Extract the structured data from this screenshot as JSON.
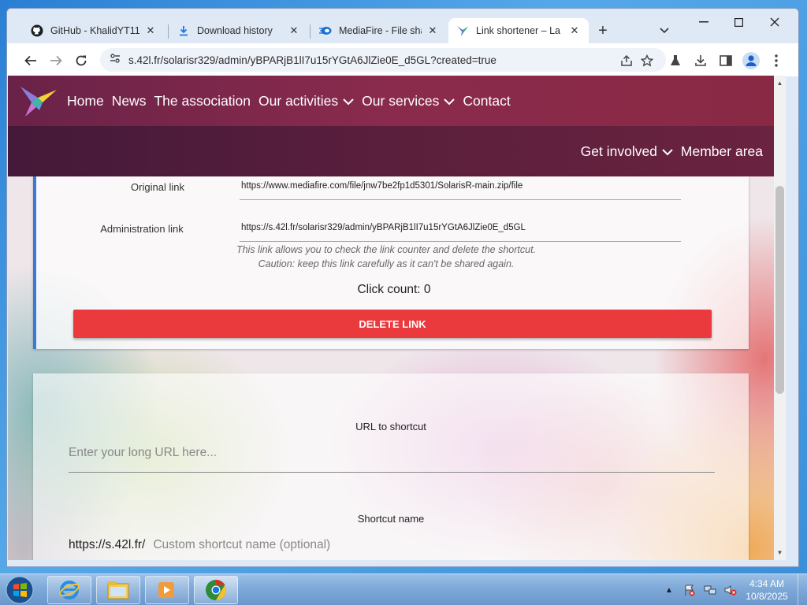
{
  "browser": {
    "tabs": [
      {
        "title": "GitHub - KhalidYT11...",
        "icon": "github-icon"
      },
      {
        "title": "Download history",
        "icon": "download-icon"
      },
      {
        "title": "MediaFire - File shar...",
        "icon": "mediafire-icon"
      },
      {
        "title": "Link shortener – La C",
        "icon": "hummingbird-icon",
        "active": true
      }
    ],
    "url": "s.42l.fr/solarisr329/admin/yBPARjB1lI7u15rYGtA6JlZie0E_d5GL?created=true"
  },
  "site": {
    "nav": {
      "home": "Home",
      "news": "News",
      "association": "The association",
      "activities": "Our activities",
      "services": "Our services",
      "contact": "Contact",
      "get_involved": "Get involved",
      "member_area": "Member area"
    },
    "result": {
      "original_label": "Original link",
      "original_value": "https://www.mediafire.com/file/jnw7be2fp1d5301/SolarisR-main.zip/file",
      "admin_label": "Administration link",
      "admin_value": "https://s.42l.fr/solarisr329/admin/yBPARjB1lI7u15rYGtA6JlZie0E_d5GL",
      "hint_line1": "This link allows you to check the link counter and delete the shortcut.",
      "hint_line2": "Caution: keep this link carefully as it can't be shared again.",
      "click_count": "Click count: 0",
      "delete_button": "DELETE LINK"
    },
    "form": {
      "url_label": "URL to shortcut",
      "url_placeholder": "Enter your long URL here...",
      "shortcut_label": "Shortcut name",
      "shortcut_prefix": "https://s.42l.fr/",
      "shortcut_placeholder": "Custom shortcut name (optional)"
    }
  },
  "taskbar": {
    "time": "4:34 AM",
    "date": "10/8/2025"
  },
  "colors": {
    "nav_top": "#8a2b4d",
    "nav_bottom": "#5a1f3c",
    "delete_button": "#ea3a3e",
    "card_accent": "#3a7ad6"
  }
}
